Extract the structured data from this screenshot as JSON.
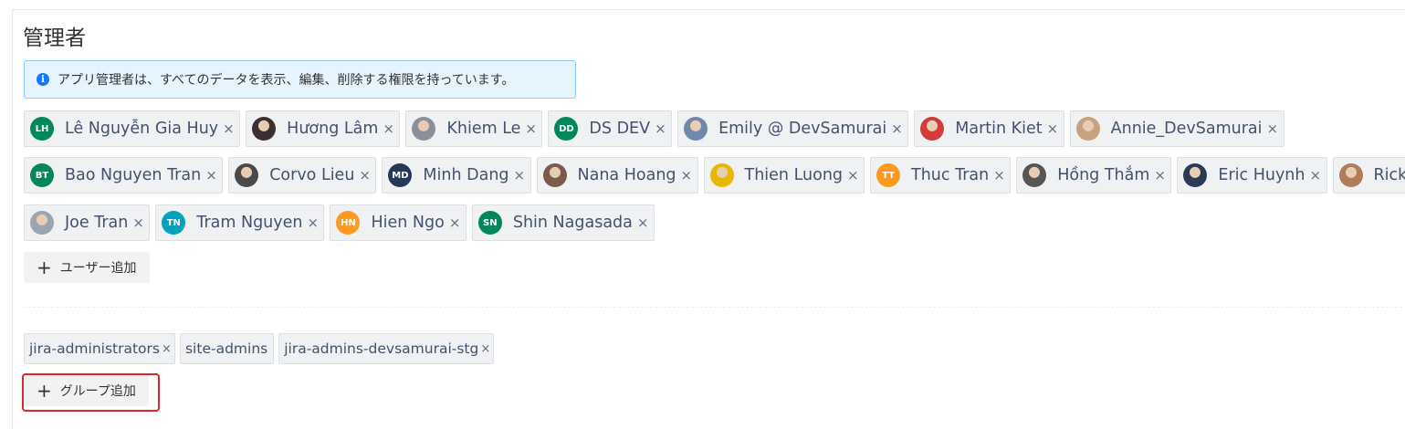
{
  "section": {
    "title": "管理者",
    "info_text": "アプリ管理者は、すべてのデータを表示、編集、削除する権限を持っています。",
    "info_icon": "info-icon"
  },
  "users": {
    "rows": [
      [
        {
          "name": "Lê Nguyễn Gia Huy",
          "initials": "LH",
          "color": "#00875A"
        },
        {
          "name": "Hương Lâm",
          "initials": "",
          "color": "#3b2f2f"
        },
        {
          "name": "Khiem Le",
          "initials": "",
          "color": "#8a8f99"
        },
        {
          "name": "DS DEV",
          "initials": "DD",
          "color": "#00875A"
        },
        {
          "name": "Emily @ DevSamurai",
          "initials": "",
          "color": "#6d8aa8"
        },
        {
          "name": "Martin Kiet",
          "initials": "",
          "color": "#d33a3a"
        },
        {
          "name": "Annie_DevSamurai",
          "initials": "",
          "color": "#c8a27c"
        }
      ],
      [
        {
          "name": "Bao Nguyen Tran",
          "initials": "BT",
          "color": "#00875A"
        },
        {
          "name": "Corvo Lieu",
          "initials": "",
          "color": "#4a4a4a"
        },
        {
          "name": "Minh Dang",
          "initials": "MD",
          "color": "#253858"
        },
        {
          "name": "Nana Hoang",
          "initials": "",
          "color": "#7a5c4a"
        },
        {
          "name": "Thien Luong",
          "initials": "",
          "color": "#e6b800"
        },
        {
          "name": "Thuc Tran",
          "initials": "TT",
          "color": "#FF991F"
        },
        {
          "name": "Hồng Thắm",
          "initials": "",
          "color": "#555555"
        },
        {
          "name": "Eric Huynh",
          "initials": "",
          "color": "#2b3a55"
        },
        {
          "name": "Ricky Ng",
          "initials": "",
          "color": "#b07d5a"
        }
      ],
      [
        {
          "name": "Joe Tran",
          "initials": "",
          "color": "#9aa5b1"
        },
        {
          "name": "Tram Nguyen",
          "initials": "TN",
          "color": "#00A3BF"
        },
        {
          "name": "Hien Ngo",
          "initials": "HN",
          "color": "#FF991F"
        },
        {
          "name": "Shin Nagasada",
          "initials": "SN",
          "color": "#00875A"
        }
      ]
    ],
    "remove_glyph": "×",
    "add_label": "ユーザー追加",
    "add_glyph": "+"
  },
  "groups": {
    "items": [
      {
        "name": "jira-administrators",
        "removable": true
      },
      {
        "name": "site-admins",
        "removable": false
      },
      {
        "name": "jira-admins-devsamurai-stg",
        "removable": true
      }
    ],
    "remove_glyph": "×",
    "add_label": "グループ追加",
    "add_glyph": "+"
  }
}
